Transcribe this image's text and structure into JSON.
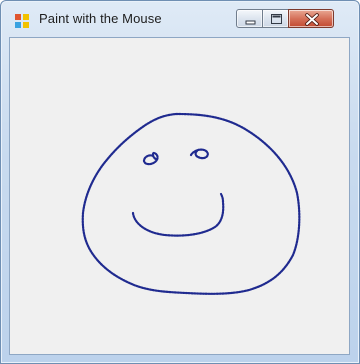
{
  "window": {
    "title": "Paint with the Mouse"
  },
  "icons": {
    "app": "app-icon",
    "minimize": "minimize-icon",
    "maximize": "maximize-icon",
    "close": "close-icon"
  },
  "colors": {
    "stroke": "#1f2a8f",
    "canvas_background": "#f0f0f0",
    "close_button": "#c9503a"
  }
}
